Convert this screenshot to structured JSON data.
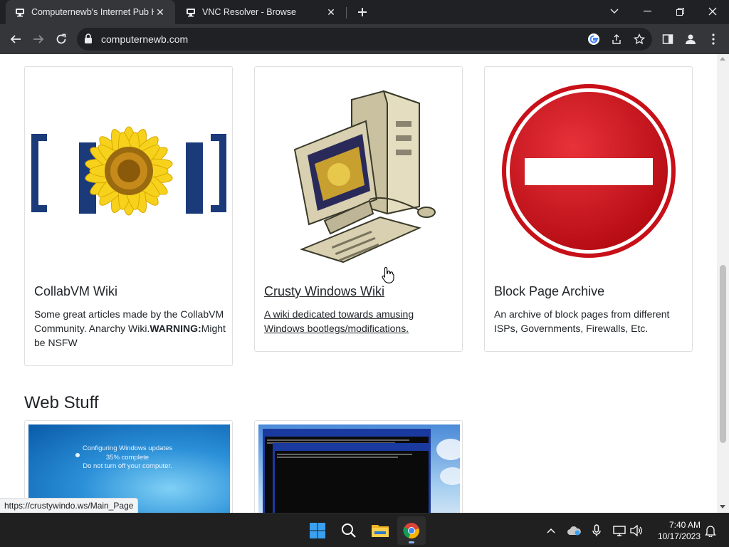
{
  "browser": {
    "tabs": [
      {
        "title": "Computernewb's Internet Pub H",
        "active": true
      },
      {
        "title": "VNC Resolver - Browse",
        "active": false
      }
    ],
    "url": "computernewb.com"
  },
  "cards_row1": [
    {
      "title": "CollabVM Wiki",
      "desc_prefix": "Some great articles made by the CollabVM Community. Anarchy Wiki.",
      "desc_bold": "WARNING:",
      "desc_suffix": "Might be NSFW",
      "thumb": "sunflower-logo"
    },
    {
      "title": "Crusty Windows Wiki",
      "desc": "A wiki dedicated towards amusing Windows bootlegs/modifications.",
      "thumb": "retro-computer",
      "hovered": true
    },
    {
      "title": "Block Page Archive",
      "desc": "An archive of block pages from different ISPs, Governments, Firewalls, Etc.",
      "thumb": "no-entry-sign"
    }
  ],
  "section": {
    "heading": "Web Stuff"
  },
  "cards_row2": [
    {
      "thumb": "windows-update-screen",
      "thumb_lines": [
        "Configuring Windows updates",
        "35% complete",
        "Do not turn off your computer."
      ]
    },
    {
      "thumb": "console-window-screenshot"
    }
  ],
  "status_url": "https://crustywindo.ws/Main_Page",
  "taskbar": {
    "time": "7:40 AM",
    "date": "10/17/2023"
  },
  "colors": {
    "accent": "#8ab4f8",
    "page_bg": "#ffffff",
    "chrome_bg": "#202124",
    "toolbar_bg": "#35363a"
  }
}
